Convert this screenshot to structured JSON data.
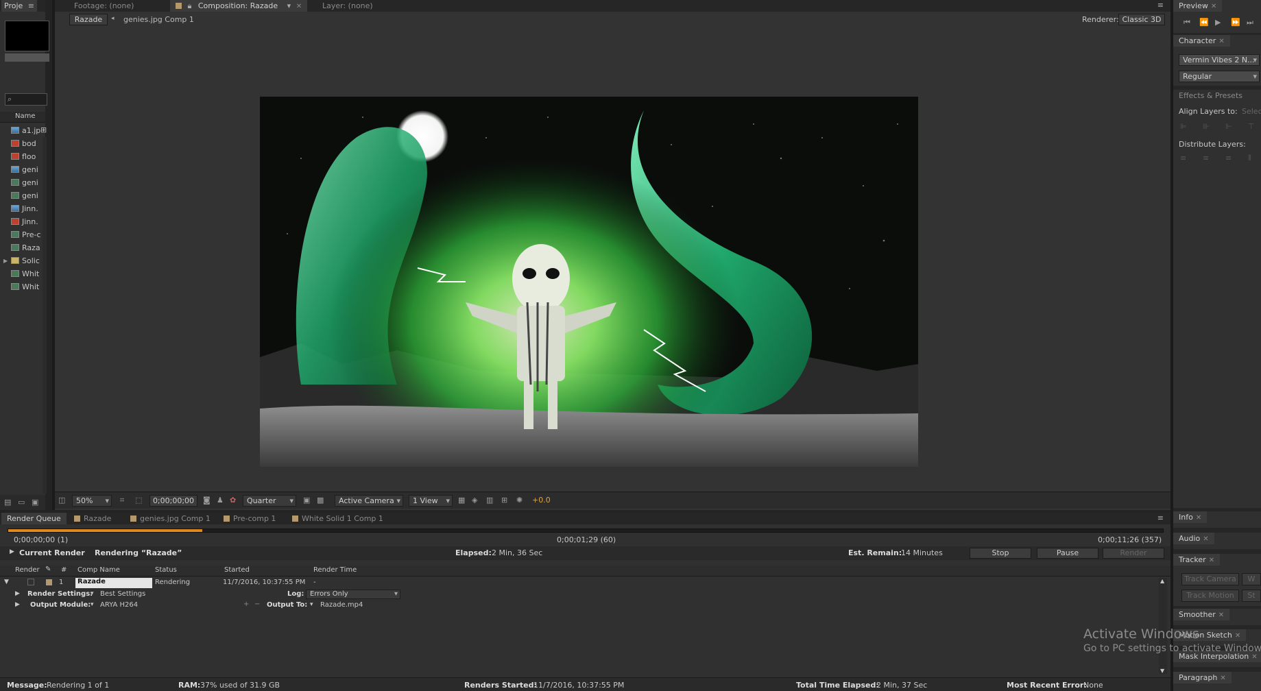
{
  "project": {
    "tab_label": "Proje",
    "column_name": "Name",
    "items": [
      {
        "label": "a1.jp",
        "icon": "image-footage-icon"
      },
      {
        "label": "bod",
        "icon": "psd-footage-icon"
      },
      {
        "label": "floo",
        "icon": "psd-footage-icon"
      },
      {
        "label": "geni",
        "icon": "image-footage-icon"
      },
      {
        "label": "geni",
        "icon": "composition-icon"
      },
      {
        "label": "geni",
        "icon": "composition-icon"
      },
      {
        "label": "Jinn.",
        "icon": "image-footage-icon"
      },
      {
        "label": "Jinn.",
        "icon": "psd-footage-icon"
      },
      {
        "label": "Pre-c",
        "icon": "composition-icon"
      },
      {
        "label": "Raza",
        "icon": "composition-icon"
      },
      {
        "label": "Solic",
        "icon": "folder-icon"
      },
      {
        "label": "Whit",
        "icon": "composition-icon"
      },
      {
        "label": "Whit",
        "icon": "composition-icon"
      }
    ]
  },
  "viewer": {
    "tab_footage": "Footage: (none)",
    "tab_composition": "Composition: Razade",
    "tab_layer": "Layer: (none)",
    "breadcrumb_active": "Razade",
    "breadcrumb_next": "genies.jpg Comp 1",
    "renderer_label": "Renderer:",
    "renderer_value": "Classic 3D",
    "zoom": "50%",
    "timecode": "0;00;00;00",
    "resolution": "Quarter",
    "camera": "Active Camera",
    "views": "1 View",
    "exposure": "+0.0"
  },
  "right_panels": {
    "preview": "Preview",
    "character": "Character",
    "font_family": "Vermin Vibes 2 N...",
    "font_style": "Regular",
    "effects_presets": "Effects & Presets",
    "align_layers_to": "Align Layers to:",
    "align_target": "Selec",
    "distribute_layers": "Distribute Layers:",
    "info": "Info",
    "audio": "Audio",
    "tracker": "Tracker",
    "track_camera": "Track Camera",
    "track_motion": "Track Motion",
    "warp_short": "W",
    "stab_short": "St",
    "smoother": "Smoother",
    "motion_sketch": "Motion Sketch",
    "mask_interpolation": "Mask Interpolation",
    "paragraph": "Paragraph"
  },
  "render_queue": {
    "tabs": [
      "Render Queue",
      "Razade",
      "genies.jpg Comp 1",
      "Pre-comp 1",
      "White Solid 1 Comp 1"
    ],
    "time_start": "0;00;00;00 (1)",
    "time_current": "0;00;01;29 (60)",
    "time_end": "0;00;11;26 (357)",
    "progress": 0.168,
    "current_render_label": "Current Render",
    "rendering_text": "Rendering “Razade”",
    "elapsed_label": "Elapsed:",
    "elapsed_value": "2 Min, 36 Sec",
    "remain_label": "Est. Remain:",
    "remain_value": "14 Minutes",
    "stop": "Stop",
    "pause": "Pause",
    "render": "Render",
    "columns": {
      "render": "Render",
      "num": "#",
      "comp_name": "Comp Name",
      "status": "Status",
      "started": "Started",
      "render_time": "Render Time"
    },
    "item": {
      "num": "1",
      "comp_name": "Razade",
      "status": "Rendering",
      "started": "11/7/2016, 10:37:55 PM",
      "render_time": "-"
    },
    "render_settings_label": "Render Settings:",
    "render_settings_value": "Best Settings",
    "log_label": "Log:",
    "log_value": "Errors Only",
    "output_module_label": "Output Module:",
    "output_module_value": "ARYA H264",
    "output_to_label": "Output To:",
    "output_to_value": "Razade.mp4"
  },
  "status_bar": {
    "message_label": "Message:",
    "message_value": "Rendering 1 of 1",
    "ram_label": "RAM:",
    "ram_value": "37% used of 31.9 GB",
    "renders_started_label": "Renders Started:",
    "renders_started_value": "11/7/2016, 10:37:55 PM",
    "total_elapsed_label": "Total Time Elapsed:",
    "total_elapsed_value": "2 Min, 37 Sec",
    "recent_error_label": "Most Recent Error:",
    "recent_error_value": "None"
  },
  "watermark": {
    "line1": "Activate Windows",
    "line2": "Go to PC settings to activate Windows."
  },
  "colors": {
    "accent_progress": "#e08a1e",
    "panel_bg": "#303030",
    "frame_bg": "#232323"
  }
}
